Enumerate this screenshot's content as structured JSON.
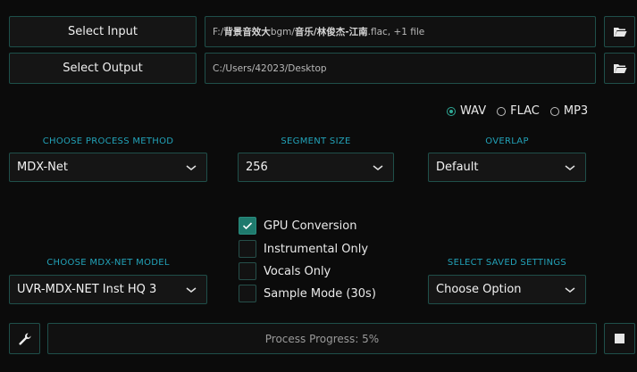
{
  "io": {
    "select_input_label": "Select Input",
    "select_output_label": "Select Output",
    "input_path_prefix": "F:/",
    "input_path_bold1": "背景音效大",
    "input_path_mid": "bgm/",
    "input_path_bold2": "音乐/林俊杰-江南",
    "input_path_suffix": ".flac, +1 file",
    "output_path": "C:/Users/42023/Desktop",
    "folder_icon": "folder-open-icon"
  },
  "format": {
    "options": [
      "WAV",
      "FLAC",
      "MP3"
    ],
    "selected": "WAV"
  },
  "process_method": {
    "label": "CHOOSE PROCESS METHOD",
    "value": "MDX-Net"
  },
  "segment_size": {
    "label": "SEGMENT SIZE",
    "value": "256"
  },
  "overlap": {
    "label": "OVERLAP",
    "value": "Default"
  },
  "model": {
    "label": "CHOOSE MDX-NET MODEL",
    "value": "UVR-MDX-NET Inst HQ 3"
  },
  "options": {
    "gpu": {
      "label": "GPU Conversion",
      "checked": true
    },
    "instrumental": {
      "label": "Instrumental Only",
      "checked": false
    },
    "vocals": {
      "label": "Vocals Only",
      "checked": false
    },
    "sample": {
      "label": "Sample Mode (30s)",
      "checked": false
    }
  },
  "saved_settings": {
    "label": "SELECT SAVED SETTINGS",
    "value": "Choose Option"
  },
  "progress": {
    "text": "Process Progress: 5%",
    "percent": 5
  },
  "colors": {
    "accent": "#22a2b8",
    "border": "#1f4f4a",
    "check_on": "#1f7a6d"
  }
}
